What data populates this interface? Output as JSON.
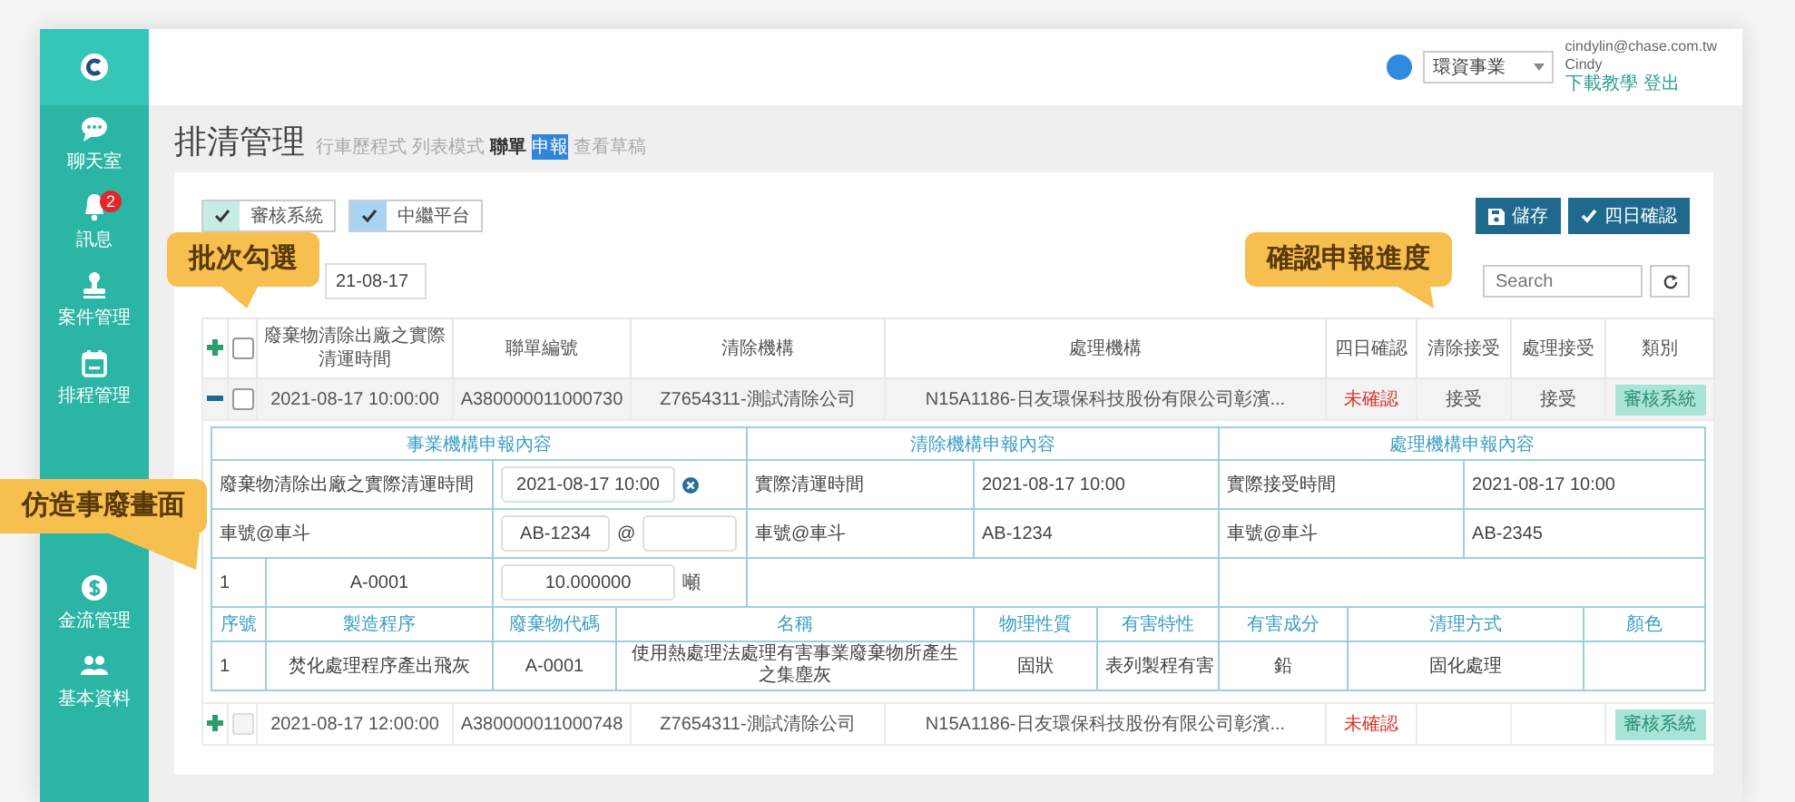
{
  "sidebar": {
    "items": [
      {
        "kind": "chat",
        "label": "聊天室"
      },
      {
        "kind": "bell",
        "label": "訊息",
        "badge": "2"
      },
      {
        "kind": "stamp",
        "label": "案件管理"
      },
      {
        "kind": "calendar",
        "label": "排程管理"
      },
      {
        "kind": "dollar",
        "label": "金流管理"
      },
      {
        "kind": "users",
        "label": "基本資料"
      }
    ]
  },
  "header": {
    "company_select": {
      "value": "環資事業"
    },
    "email": "cindylin@chase.com.tw",
    "user": "Cindy",
    "links": [
      "下載教學",
      "登出"
    ]
  },
  "title": "排清管理",
  "view_links": [
    {
      "label": "行車歷程式",
      "selected": false,
      "highlighted": false
    },
    {
      "label": "列表模式",
      "selected": false,
      "highlighted": false
    },
    {
      "label": "聯單",
      "selected": true,
      "highlighted": false
    },
    {
      "label": "申報",
      "selected": false,
      "highlighted": true
    },
    {
      "label": "查看草稿",
      "selected": false,
      "highlighted": false
    }
  ],
  "toggles": [
    {
      "label": "審核系統",
      "checked": true,
      "color": "#c6ede4"
    },
    {
      "label": "中繼平台",
      "checked": true,
      "color": "#a9d3f3"
    }
  ],
  "buttons": [
    {
      "kind": "save",
      "label": "儲存"
    },
    {
      "kind": "check",
      "label": "四日確認"
    }
  ],
  "date_field": {
    "value": "21-08-17"
  },
  "search": {
    "placeholder": "Search"
  },
  "table": {
    "select_all_checked": false,
    "columns": [
      "廢棄物清除出廠之實際清運時間",
      "聯單編號",
      "清除機構",
      "處理機構",
      "四日確認",
      "清除接受",
      "處理接受",
      "類別"
    ],
    "rows": [
      {
        "expanded": true,
        "checked": false,
        "disabled": false,
        "cells": [
          "2021-08-17 10:00:00",
          "A380000011000730",
          "Z7654311-測試清除公司",
          "N15A1186-日友環保科技股份有限公司彰濱...",
          "未確認",
          "接受",
          "接受"
        ],
        "confirmed": false,
        "category": "審核系統",
        "detail": {
          "sections": [
            "事業機構申報內容",
            "清除機構申報內容",
            "處理機構申報內容"
          ],
          "time_row": {
            "label": "廢棄物清除出廠之實際清運時間",
            "value": "2021-08-17 10:00",
            "clear_label": "實際清運時間",
            "clear_value": "2021-08-17 10:00",
            "treat_label": "實際接受時間",
            "treat_value": "2021-08-17 10:00"
          },
          "plate_row": {
            "label": "車號@車斗",
            "value": "AB-1234",
            "separator": "@",
            "clear_label": "車號@車斗",
            "clear_value": "AB-1234",
            "treat_label": "車號@車斗",
            "treat_value": "AB-2345"
          },
          "qty_row": {
            "index": "1",
            "code": "A-0001",
            "value": "10.000000",
            "unit": "噸"
          },
          "waste_columns": [
            "序號",
            "製造程序",
            "廢棄物代碼",
            "名稱",
            "物理性質",
            "有害特性",
            "有害成分",
            "清理方式",
            "顏色"
          ],
          "waste_rows": [
            [
              "1",
              "焚化處理程序產出飛灰",
              "A-0001",
              "使用熱處理法處理有害事業廢棄物所產生之集塵灰",
              "固狀",
              "表列製程有害",
              "鉛",
              "固化處理"
            ]
          ]
        }
      },
      {
        "expanded": false,
        "checked": false,
        "disabled": true,
        "cells": [
          "2021-08-17 12:00:00",
          "A380000011000748",
          "Z7654311-測試清除公司",
          "N15A1186-日友環保科技股份有限公司彰濱...",
          "未確認"
        ],
        "confirmed": false,
        "category": "審核系統"
      }
    ]
  },
  "callouts": [
    {
      "kind": "batch",
      "text": "批次勾選"
    },
    {
      "kind": "progress",
      "text": "確認申報進度"
    },
    {
      "kind": "form",
      "text": "仿造事廢畫面"
    }
  ]
}
